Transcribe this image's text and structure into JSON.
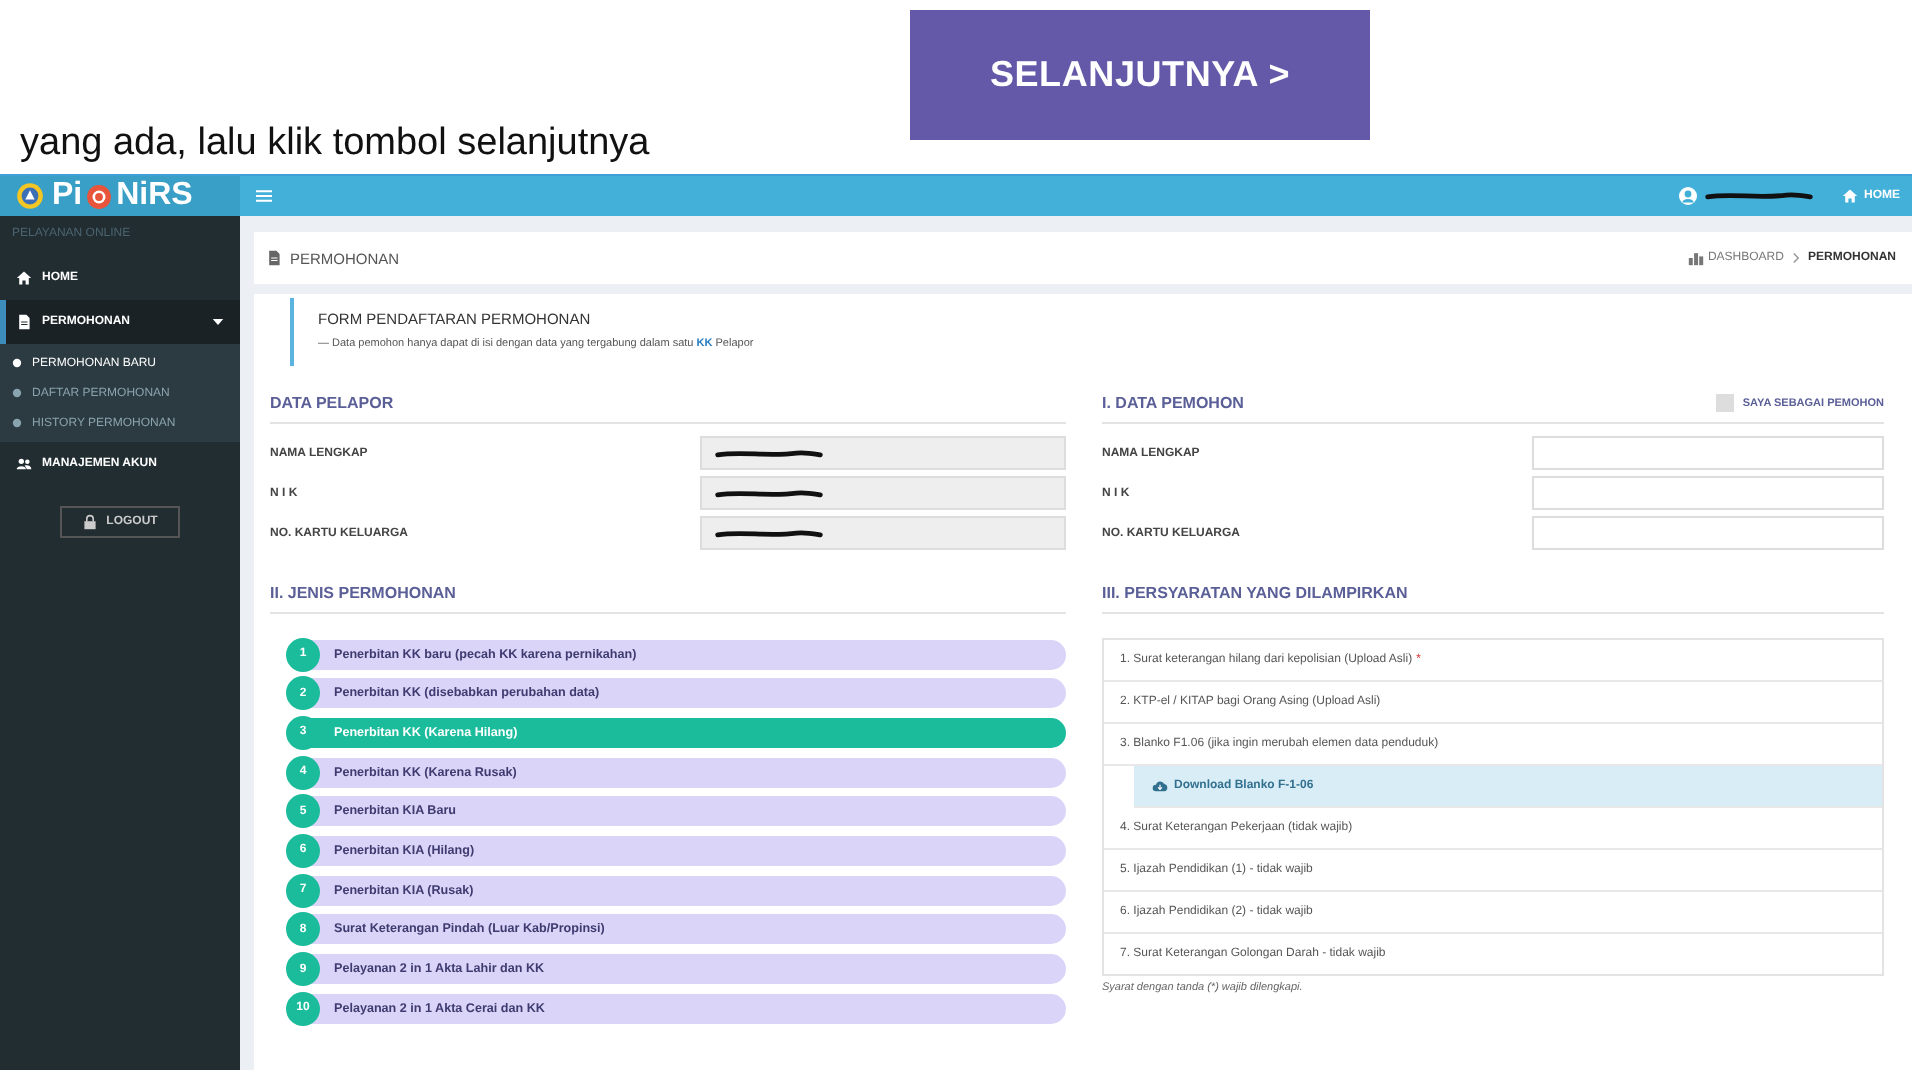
{
  "document": {
    "text": "yang ada, lalu klik tombol selanjutnya",
    "button": "SELANJUTNYA >"
  },
  "app": {
    "logo": [
      "Pi",
      "NiRS"
    ],
    "header": {
      "home": "HOME"
    },
    "sidebar": {
      "section": "PELAYANAN ONLINE",
      "items": [
        {
          "label": "HOME",
          "selected": false
        },
        {
          "label": "PERMOHONAN",
          "selected": true,
          "expanded": true,
          "children": [
            {
              "label": "PERMOHONAN BARU",
              "selected": true
            },
            {
              "label": "DAFTAR PERMOHONAN",
              "selected": false
            },
            {
              "label": "HISTORY PERMOHONAN",
              "selected": false
            }
          ]
        },
        {
          "label": "MANAJEMEN AKUN",
          "selected": false
        }
      ],
      "logout": "LOGOUT"
    },
    "breadcrumb": {
      "title": "PERMOHONAN",
      "crumbs": [
        "DASHBOARD",
        "PERMOHONAN"
      ]
    },
    "form": {
      "title": "FORM PENDAFTARAN PERMOHONAN",
      "note": "— Data pemohon hanya dapat di isi dengan data yang tergabung dalam satu **KK** Pelapor"
    },
    "data_pelapor": {
      "heading": "DATA PELAPOR",
      "fields": [
        {
          "label": "NAMA LENGKAP",
          "redacted": true
        },
        {
          "label": "N I K",
          "redacted": true
        },
        {
          "label": "NO. KARTU KELUARGA",
          "redacted": true
        }
      ]
    },
    "data_pemohon": {
      "heading": "I. DATA PEMOHON",
      "checkbox": {
        "label": "SAYA SEBAGAI PEMOHON",
        "checked": false
      },
      "fields": [
        {
          "label": "NAMA LENGKAP"
        },
        {
          "label": "N I K"
        },
        {
          "label": "NO. KARTU KELUARGA"
        }
      ]
    },
    "jenis_permohonan": {
      "heading": "II. JENIS PERMOHONAN",
      "items": [
        {
          "number": "1",
          "label": "Penerbitan KK baru (pecah KK karena pernikahan)",
          "selected": false
        },
        {
          "number": "2",
          "label": "Penerbitan KK (disebabkan perubahan data)",
          "selected": false
        },
        {
          "number": "3",
          "label": "Penerbitan KK (Karena Hilang)",
          "selected": true
        },
        {
          "number": "4",
          "label": "Penerbitan KK (Karena Rusak)",
          "selected": false
        },
        {
          "number": "5",
          "label": "Penerbitan KIA Baru",
          "selected": false
        },
        {
          "number": "6",
          "label": "Penerbitan KIA (Hilang)",
          "selected": false
        },
        {
          "number": "7",
          "label": "Penerbitan KIA (Rusak)",
          "selected": false
        },
        {
          "number": "8",
          "label": "Surat Keterangan Pindah (Luar Kab/Propinsi)",
          "selected": false
        },
        {
          "number": "9",
          "label": "Pelayanan 2 in 1 Akta Lahir dan KK",
          "selected": false
        },
        {
          "number": "10",
          "label": "Pelayanan 2 in 1 Akta Cerai dan KK",
          "selected": false
        }
      ]
    },
    "persyaratan": {
      "heading": "III. PERSYARATAN YANG DILAMPIRKAN",
      "items": [
        {
          "kind": "requirement",
          "label": "1. Surat keterangan hilang dari kepolisian (Upload Asli)",
          "mark": "*"
        },
        {
          "kind": "requirement",
          "label": "2. KTP-el / KITAP bagi Orang Asing (Upload Asli)"
        },
        {
          "kind": "requirement",
          "label": "3. Blanko F1.06 (jika ingin merubah elemen data penduduk)"
        },
        {
          "kind": "download",
          "label": "Download Blanko F-1-06"
        },
        {
          "kind": "requirement",
          "label": "4. Surat Keterangan Pekerjaan (tidak wajib)"
        },
        {
          "kind": "requirement",
          "label": "5. Ijazah Pendidikan (1) - tidak wajib"
        },
        {
          "kind": "requirement",
          "label": "6. Ijazah Pendidikan (2) - tidak wajib"
        },
        {
          "kind": "requirement",
          "label": "7. Surat Keterangan Golongan Darah - tidak wajib"
        }
      ],
      "footnote": "Syarat dengan tanda (*) wajib dilengkapi."
    }
  }
}
